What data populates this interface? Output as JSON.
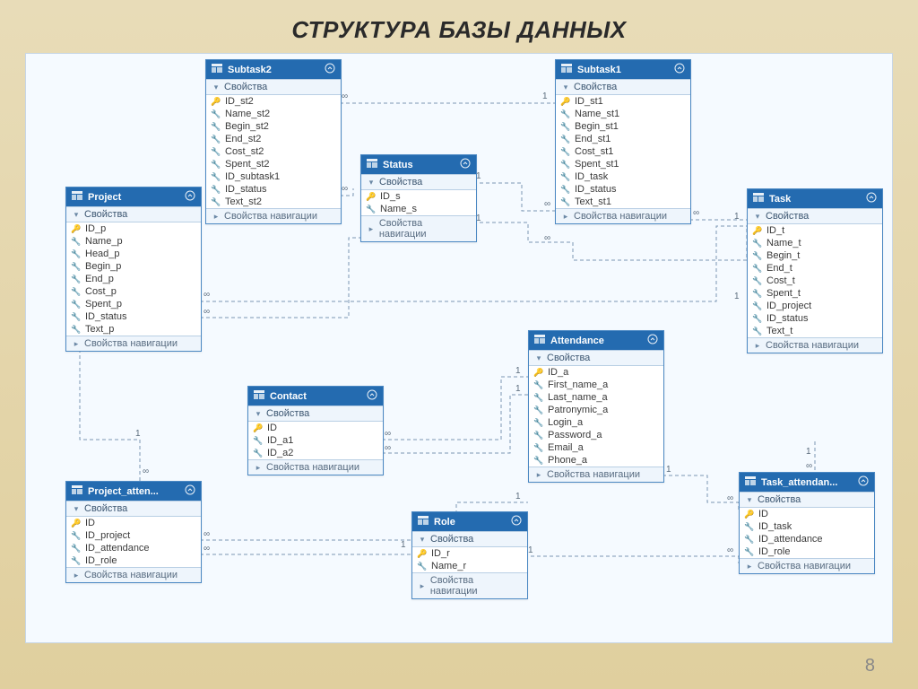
{
  "title": "СТРУКТУРА БАЗЫ ДАННЫХ",
  "page_number": "8",
  "section_label": "Свойства",
  "nav_label": "Свойства навигации",
  "entities": {
    "project": {
      "name": "Project",
      "fields": [
        "ID_p",
        "Name_p",
        "Head_p",
        "Begin_p",
        "End_p",
        "Cost_p",
        "Spent_p",
        "ID_status",
        "Text_p"
      ],
      "pk": 0
    },
    "subtask2": {
      "name": "Subtask2",
      "fields": [
        "ID_st2",
        "Name_st2",
        "Begin_st2",
        "End_st2",
        "Cost_st2",
        "Spent_st2",
        "ID_subtask1",
        "ID_status",
        "Text_st2"
      ],
      "pk": 0
    },
    "status": {
      "name": "Status",
      "fields": [
        "ID_s",
        "Name_s"
      ],
      "pk": 0
    },
    "subtask1": {
      "name": "Subtask1",
      "fields": [
        "ID_st1",
        "Name_st1",
        "Begin_st1",
        "End_st1",
        "Cost_st1",
        "Spent_st1",
        "ID_task",
        "ID_status",
        "Text_st1"
      ],
      "pk": 0
    },
    "task": {
      "name": "Task",
      "fields": [
        "ID_t",
        "Name_t",
        "Begin_t",
        "End_t",
        "Cost_t",
        "Spent_t",
        "ID_project",
        "ID_status",
        "Text_t"
      ],
      "pk": 0
    },
    "contact": {
      "name": "Contact",
      "fields": [
        "ID",
        "ID_a1",
        "ID_a2"
      ],
      "pk": 0
    },
    "attendance": {
      "name": "Attendance",
      "fields": [
        "ID_a",
        "First_name_a",
        "Last_name_a",
        "Patronymic_a",
        "Login_a",
        "Password_a",
        "Email_a",
        "Phone_a"
      ],
      "pk": 0
    },
    "role": {
      "name": "Role",
      "fields": [
        "ID_r",
        "Name_r"
      ],
      "pk": 0
    },
    "project_atten": {
      "name": "Project_atten...",
      "fields": [
        "ID",
        "ID_project",
        "ID_attendance",
        "ID_role"
      ],
      "pk": 0
    },
    "task_attendan": {
      "name": "Task_attendan...",
      "fields": [
        "ID",
        "ID_task",
        "ID_attendance",
        "ID_role"
      ],
      "pk": 0
    }
  },
  "cardinality": {
    "one": "1",
    "many": "∞"
  }
}
